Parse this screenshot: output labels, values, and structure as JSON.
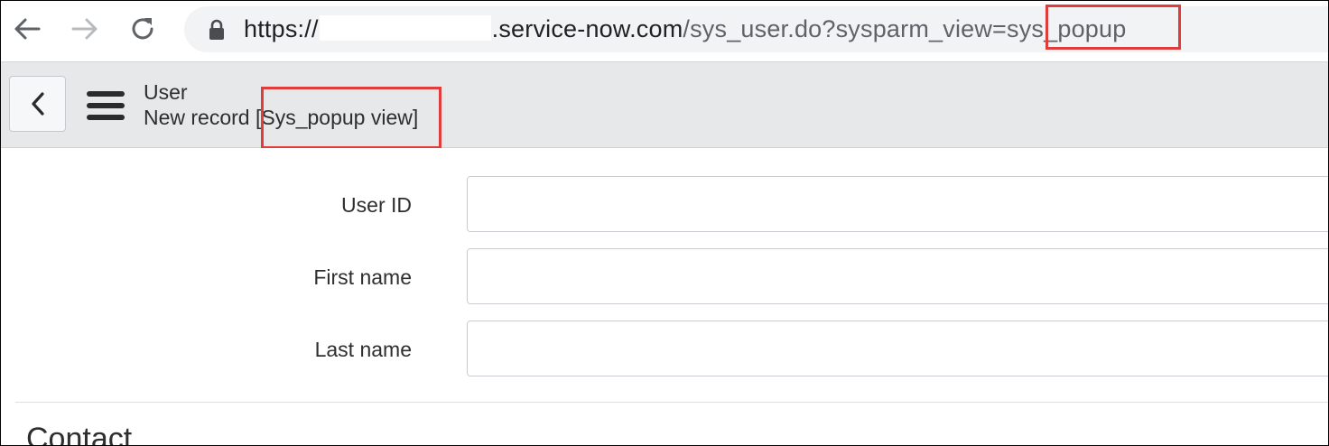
{
  "browser": {
    "url_scheme": "https://",
    "url_host_tail": ".service-now.com",
    "url_path_prefix": "/sys_user.do?sysparm_view=",
    "url_view_param": "sys_popup",
    "icons": [
      "back-arrow-icon",
      "forward-arrow-icon",
      "reload-icon",
      "lock-icon"
    ]
  },
  "header": {
    "table": "User",
    "record_prefix": "New record ",
    "view_label": "[Sys_popup view]",
    "icons": [
      "chevron-left-icon",
      "hamburger-menu-icon"
    ]
  },
  "form": {
    "fields": [
      {
        "label": "User ID",
        "value": ""
      },
      {
        "label": "First name",
        "value": ""
      },
      {
        "label": "Last name",
        "value": ""
      }
    ],
    "section_heading": "Contact"
  },
  "colors": {
    "highlight": "#e03c3c",
    "header_bg": "#e6e8ea",
    "omnibox_bg": "#f1f3f4"
  }
}
